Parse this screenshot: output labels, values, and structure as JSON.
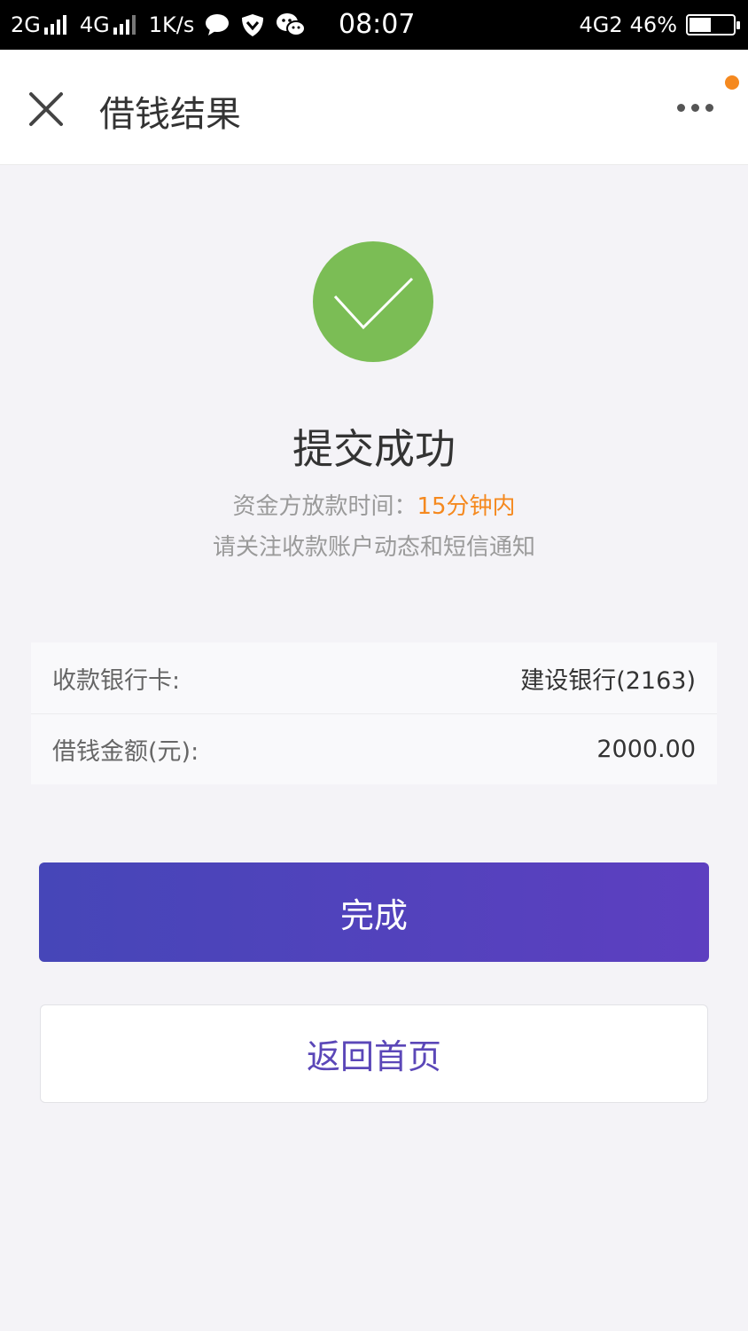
{
  "status_bar": {
    "net1": "2G",
    "net2": "4G",
    "speed": "1K/s",
    "time": "08:07",
    "net_right": "4G2",
    "battery": "46%",
    "icons": [
      "chat-bubble-icon",
      "shield-icon",
      "wechat-icon"
    ]
  },
  "nav": {
    "title": "借钱结果",
    "close_icon": "close-icon",
    "more_icon": "more-icon",
    "notification_color": "#f5891f"
  },
  "result": {
    "icon": "check-circle-icon",
    "icon_color": "#7bbd55",
    "title": "提交成功",
    "time_label": "资金方放款时间：",
    "time_value": "15分钟内",
    "notice": "请关注收款账户动态和短信通知"
  },
  "info": {
    "rows": [
      {
        "label": "收款银行卡:",
        "value": "建设银行(2163)"
      },
      {
        "label": "借钱金额(元):",
        "value": "2000.00"
      }
    ]
  },
  "buttons": {
    "primary": "完成",
    "secondary": "返回首页",
    "primary_color": "#4f44bc",
    "secondary_text_color": "#5b47b8"
  }
}
